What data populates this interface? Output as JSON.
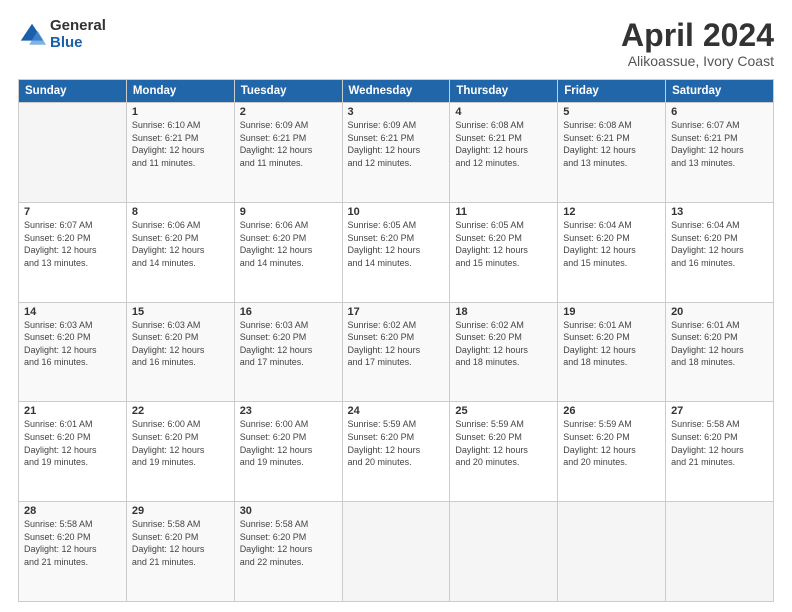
{
  "logo": {
    "general": "General",
    "blue": "Blue"
  },
  "header": {
    "month": "April 2024",
    "location": "Alikoassue, Ivory Coast"
  },
  "days_of_week": [
    "Sunday",
    "Monday",
    "Tuesday",
    "Wednesday",
    "Thursday",
    "Friday",
    "Saturday"
  ],
  "weeks": [
    [
      {
        "day": "",
        "info": ""
      },
      {
        "day": "1",
        "info": "Sunrise: 6:10 AM\nSunset: 6:21 PM\nDaylight: 12 hours\nand 11 minutes."
      },
      {
        "day": "2",
        "info": "Sunrise: 6:09 AM\nSunset: 6:21 PM\nDaylight: 12 hours\nand 11 minutes."
      },
      {
        "day": "3",
        "info": "Sunrise: 6:09 AM\nSunset: 6:21 PM\nDaylight: 12 hours\nand 12 minutes."
      },
      {
        "day": "4",
        "info": "Sunrise: 6:08 AM\nSunset: 6:21 PM\nDaylight: 12 hours\nand 12 minutes."
      },
      {
        "day": "5",
        "info": "Sunrise: 6:08 AM\nSunset: 6:21 PM\nDaylight: 12 hours\nand 13 minutes."
      },
      {
        "day": "6",
        "info": "Sunrise: 6:07 AM\nSunset: 6:21 PM\nDaylight: 12 hours\nand 13 minutes."
      }
    ],
    [
      {
        "day": "7",
        "info": "Sunrise: 6:07 AM\nSunset: 6:20 PM\nDaylight: 12 hours\nand 13 minutes."
      },
      {
        "day": "8",
        "info": "Sunrise: 6:06 AM\nSunset: 6:20 PM\nDaylight: 12 hours\nand 14 minutes."
      },
      {
        "day": "9",
        "info": "Sunrise: 6:06 AM\nSunset: 6:20 PM\nDaylight: 12 hours\nand 14 minutes."
      },
      {
        "day": "10",
        "info": "Sunrise: 6:05 AM\nSunset: 6:20 PM\nDaylight: 12 hours\nand 14 minutes."
      },
      {
        "day": "11",
        "info": "Sunrise: 6:05 AM\nSunset: 6:20 PM\nDaylight: 12 hours\nand 15 minutes."
      },
      {
        "day": "12",
        "info": "Sunrise: 6:04 AM\nSunset: 6:20 PM\nDaylight: 12 hours\nand 15 minutes."
      },
      {
        "day": "13",
        "info": "Sunrise: 6:04 AM\nSunset: 6:20 PM\nDaylight: 12 hours\nand 16 minutes."
      }
    ],
    [
      {
        "day": "14",
        "info": "Sunrise: 6:03 AM\nSunset: 6:20 PM\nDaylight: 12 hours\nand 16 minutes."
      },
      {
        "day": "15",
        "info": "Sunrise: 6:03 AM\nSunset: 6:20 PM\nDaylight: 12 hours\nand 16 minutes."
      },
      {
        "day": "16",
        "info": "Sunrise: 6:03 AM\nSunset: 6:20 PM\nDaylight: 12 hours\nand 17 minutes."
      },
      {
        "day": "17",
        "info": "Sunrise: 6:02 AM\nSunset: 6:20 PM\nDaylight: 12 hours\nand 17 minutes."
      },
      {
        "day": "18",
        "info": "Sunrise: 6:02 AM\nSunset: 6:20 PM\nDaylight: 12 hours\nand 18 minutes."
      },
      {
        "day": "19",
        "info": "Sunrise: 6:01 AM\nSunset: 6:20 PM\nDaylight: 12 hours\nand 18 minutes."
      },
      {
        "day": "20",
        "info": "Sunrise: 6:01 AM\nSunset: 6:20 PM\nDaylight: 12 hours\nand 18 minutes."
      }
    ],
    [
      {
        "day": "21",
        "info": "Sunrise: 6:01 AM\nSunset: 6:20 PM\nDaylight: 12 hours\nand 19 minutes."
      },
      {
        "day": "22",
        "info": "Sunrise: 6:00 AM\nSunset: 6:20 PM\nDaylight: 12 hours\nand 19 minutes."
      },
      {
        "day": "23",
        "info": "Sunrise: 6:00 AM\nSunset: 6:20 PM\nDaylight: 12 hours\nand 19 minutes."
      },
      {
        "day": "24",
        "info": "Sunrise: 5:59 AM\nSunset: 6:20 PM\nDaylight: 12 hours\nand 20 minutes."
      },
      {
        "day": "25",
        "info": "Sunrise: 5:59 AM\nSunset: 6:20 PM\nDaylight: 12 hours\nand 20 minutes."
      },
      {
        "day": "26",
        "info": "Sunrise: 5:59 AM\nSunset: 6:20 PM\nDaylight: 12 hours\nand 20 minutes."
      },
      {
        "day": "27",
        "info": "Sunrise: 5:58 AM\nSunset: 6:20 PM\nDaylight: 12 hours\nand 21 minutes."
      }
    ],
    [
      {
        "day": "28",
        "info": "Sunrise: 5:58 AM\nSunset: 6:20 PM\nDaylight: 12 hours\nand 21 minutes."
      },
      {
        "day": "29",
        "info": "Sunrise: 5:58 AM\nSunset: 6:20 PM\nDaylight: 12 hours\nand 21 minutes."
      },
      {
        "day": "30",
        "info": "Sunrise: 5:58 AM\nSunset: 6:20 PM\nDaylight: 12 hours\nand 22 minutes."
      },
      {
        "day": "",
        "info": ""
      },
      {
        "day": "",
        "info": ""
      },
      {
        "day": "",
        "info": ""
      },
      {
        "day": "",
        "info": ""
      }
    ]
  ]
}
